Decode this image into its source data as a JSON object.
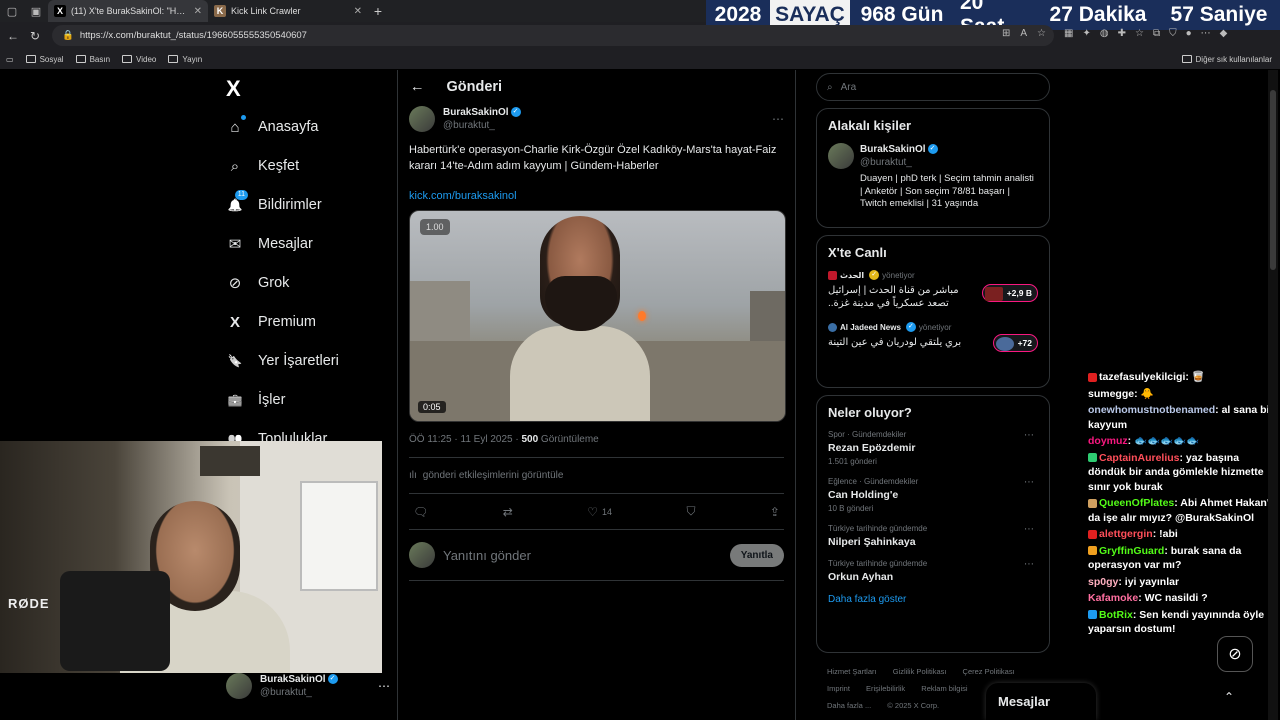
{
  "browser": {
    "tabs": [
      {
        "title": "(11) X'te BurakSakinOl: \"Habertürk'e",
        "favicon": "X"
      },
      {
        "title": "Kick Link Crawler",
        "favicon": "K"
      }
    ],
    "url": "https://x.com/buraktut_/status/1966055555350540607",
    "bookmarks": [
      "Sosyal",
      "Basın",
      "Video",
      "Yayın"
    ],
    "other_bookmarks": "Diğer sık kullanılanlar"
  },
  "counter": {
    "year": "2028",
    "label": "SAYAÇ",
    "days": "968 Gün",
    "hours": "20 Saat",
    "minutes": "27 Dakika",
    "seconds": "57 Saniye"
  },
  "sidebar": {
    "logo": "X",
    "items": [
      {
        "label": "Anasayfa",
        "icon": "⌂"
      },
      {
        "label": "Keşfet",
        "icon": "⌕"
      },
      {
        "label": "Bildirimler",
        "icon": "🔔",
        "badge": "11"
      },
      {
        "label": "Mesajlar",
        "icon": "✉"
      },
      {
        "label": "Grok",
        "icon": "⊘"
      },
      {
        "label": "Premium",
        "icon": "X"
      },
      {
        "label": "Yer İşaretleri",
        "icon": "🔖"
      },
      {
        "label": "İşler",
        "icon": "💼"
      },
      {
        "label": "Topluluklar",
        "icon": "👥"
      }
    ],
    "account": {
      "name": "BurakSakinOl",
      "handle": "@buraktut_"
    }
  },
  "main": {
    "header": "Gönderi",
    "post": {
      "name": "BurakSakinOl",
      "handle": "@buraktut_",
      "text": "Habertürk'e operasyon-Charlie Kirk-Özgür Özel Kadıköy-Mars'ta hayat-Faiz kararı 14'te-Adım adım kayyum | Gündem-Haberler",
      "link": "kick.com/buraksakinol",
      "video_speed": "1.00",
      "video_duration": "0:05",
      "time": "ÖÖ 11:25 · 11 Eyl 2025 · ",
      "views": "500",
      "views_label": " Görüntüleme",
      "engagements": "gönderi etkileşimlerini görüntüle",
      "likes": "14"
    },
    "reply": {
      "placeholder": "Yanıtını gönder",
      "button": "Yanıtla"
    }
  },
  "right": {
    "search_placeholder": "Ara",
    "related": {
      "title": "Alakalı kişiler",
      "name": "BurakSakinOl",
      "handle": "@buraktut_",
      "bio": "Duayen | phD terk | Seçim tahmin analisti | Anketör | Son seçim 78/81 başarı | Twitch emeklisi | 31 yaşında"
    },
    "live": {
      "title": "X'te Canlı",
      "items": [
        {
          "source": "الحدث",
          "status": "yönetiyor",
          "text": "مباشر من قناة الحدث | إسرائيل تصعد عسكرياً في مدينة غزة..",
          "count": "+2,9 B"
        },
        {
          "source": "Al Jadeed News",
          "status": "yönetiyor",
          "text": "بري يلتقي لودريان في عين التينة",
          "count": "+72"
        }
      ]
    },
    "trends": {
      "title": "Neler oluyor?",
      "items": [
        {
          "category": "Spor · Gündemdekiler",
          "topic": "Rezan Epözdemir",
          "count": "1.501 gönderi"
        },
        {
          "category": "Eğlence · Gündemdekiler",
          "topic": "Can Holding'e",
          "count": "10 B gönderi"
        },
        {
          "category": "Türkiye tarihinde gündemde",
          "topic": "Nilperi Şahinkaya",
          "count": ""
        },
        {
          "category": "Türkiye tarihinde gündemde",
          "topic": "Orkun Ayhan",
          "count": ""
        }
      ],
      "show_more": "Daha fazla göster"
    },
    "footer": {
      "links1": [
        "Hizmet Şartları",
        "Gizlilik Politikası",
        "Çerez Politikası"
      ],
      "links2": [
        "Imprint",
        "Erişilebilirlik",
        "Reklam bilgisi"
      ],
      "more": "Daha fazla ...",
      "copyright": "© 2025 X Corp."
    }
  },
  "webcam": {
    "brand": "RØDE"
  },
  "chat": [
    {
      "user": "tazefasulyekilcigi",
      "text": ": 🥃",
      "color": "#ffffff",
      "icon": "#e02020"
    },
    {
      "user": "sumegge",
      "text": ": 🐥",
      "color": "#ffffff",
      "icon": ""
    },
    {
      "user": "onewhomustnotbenamed",
      "text": ": al sana bi kayyum",
      "color": "#b9c8e8",
      "icon": ""
    },
    {
      "user": "doymuz",
      "text": ": 🐟🐟🐟🐟🐟",
      "color": "#f91880",
      "icon": ""
    },
    {
      "user": "CaptainAurelius",
      "text": ": yaz başına döndük bir anda gömlekle hizmette sınır yok burak",
      "color": "#ff4f5a",
      "icon": "#2ecc71"
    },
    {
      "user": "QueenOfPlates",
      "text": ": Abi Ahmet Hakan'ı da işe alır mıyız? @BurakSakinOl",
      "color": "#53fc18",
      "icon": "#d0a060"
    },
    {
      "user": "alettgergin",
      "text": ": !abi",
      "color": "#ff4f5a",
      "icon": "#e02020"
    },
    {
      "user": "GryffinGuard",
      "text": ": burak sana da operasyon var mı?",
      "color": "#53fc18",
      "icon": "#f0a020"
    },
    {
      "user": "sp0gy",
      "text": ": iyi yayınlar",
      "color": "#ffb0c0",
      "icon": ""
    },
    {
      "user": "Kafamoke",
      "text": ": WC nasildi ?",
      "color": "#ff6fa0",
      "icon": ""
    },
    {
      "user": "BotRix",
      "text": ": Sen kendi yayınında öyle yaparsın dostum!",
      "color": "#53fc18",
      "icon": "#1d9bf0"
    }
  ],
  "dm": {
    "label": "Mesajlar"
  }
}
